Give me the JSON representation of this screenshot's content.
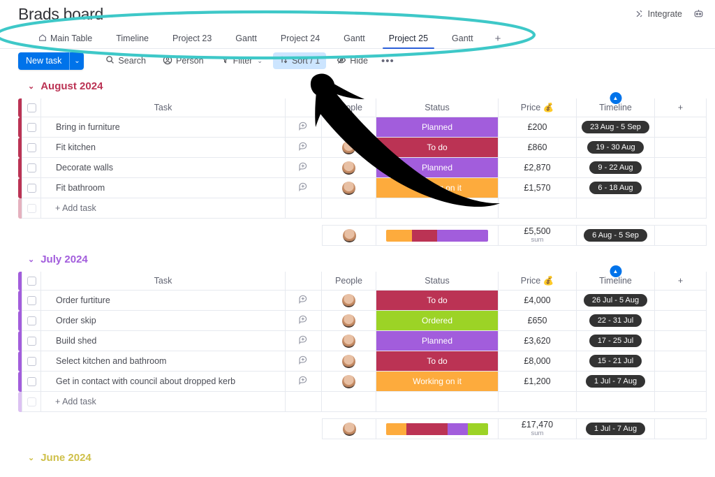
{
  "header": {
    "board_title": "Brads board",
    "title_caret": "⌄",
    "integrate_label": "Integrate",
    "automate_icon": "robot-icon"
  },
  "tabs": [
    {
      "label": "Main Table",
      "icon": "home-icon",
      "active": false
    },
    {
      "label": "Timeline",
      "active": false
    },
    {
      "label": "Project 23",
      "active": false
    },
    {
      "label": "Gantt",
      "active": false
    },
    {
      "label": "Project 24",
      "active": false
    },
    {
      "label": "Gantt",
      "active": false
    },
    {
      "label": "Project 25",
      "active": true
    },
    {
      "label": "Gantt",
      "active": false
    }
  ],
  "tab_add_label": "+",
  "toolbar": {
    "new_task_label": "New task",
    "new_task_caret": "⌄",
    "search_label": "Search",
    "person_label": "Person",
    "filter_label": "Filter",
    "filter_caret": "⌄",
    "sort_label": "Sort / 1",
    "hide_label": "Hide",
    "more_label": "•••"
  },
  "columns": {
    "task": "Task",
    "people": "People",
    "status": "Status",
    "price": "Price 💰",
    "timeline": "Timeline",
    "add": "+"
  },
  "status_colors": {
    "planned": "#a25ddc",
    "todo": "#bb3354",
    "working": "#fdab3d",
    "ordered": "#9cd326"
  },
  "accent_colors": {
    "august": "#bb3354",
    "july": "#a25ddc",
    "june": "#cfc04a"
  },
  "add_task_label": "+ Add task",
  "sum_label": "sum",
  "groups": [
    {
      "name": "August 2024",
      "caret": "⌄",
      "accent": "#bb3354",
      "rows": [
        {
          "task": "Bring in furniture",
          "status": "Planned",
          "status_color": "#a25ddc",
          "price": "£200",
          "timeline": "23 Aug - 5 Sep"
        },
        {
          "task": "Fit kitchen",
          "status": "To do",
          "status_color": "#bb3354",
          "price": "£860",
          "timeline": "19 - 30 Aug"
        },
        {
          "task": "Decorate walls",
          "status": "Planned",
          "status_color": "#a25ddc",
          "price": "£2,870",
          "timeline": "9 - 22 Aug"
        },
        {
          "task": "Fit bathroom",
          "status": "Working on it",
          "status_color": "#fdab3d",
          "price": "£1,570",
          "timeline": "6 - 18 Aug"
        }
      ],
      "summary": {
        "price": "£5,500",
        "timeline": "6 Aug - 5 Sep",
        "bar": [
          {
            "color": "#fdab3d",
            "pct": 25
          },
          {
            "color": "#bb3354",
            "pct": 25
          },
          {
            "color": "#a25ddc",
            "pct": 50
          }
        ]
      }
    },
    {
      "name": "July 2024",
      "caret": "⌄",
      "accent": "#a25ddc",
      "rows": [
        {
          "task": "Order furtiture",
          "status": "To do",
          "status_color": "#bb3354",
          "price": "£4,000",
          "timeline": "26 Jul - 5 Aug"
        },
        {
          "task": "Order skip",
          "status": "Ordered",
          "status_color": "#9cd326",
          "price": "£650",
          "timeline": "22 - 31 Jul"
        },
        {
          "task": "Build shed",
          "status": "Planned",
          "status_color": "#a25ddc",
          "price": "£3,620",
          "timeline": "17 - 25 Jul"
        },
        {
          "task": "Select kitchen and bathroom",
          "status": "To do",
          "status_color": "#bb3354",
          "price": "£8,000",
          "timeline": "15 - 21 Jul"
        },
        {
          "task": "Get in contact with council about dropped kerb",
          "status": "Working on it",
          "status_color": "#fdab3d",
          "price": "£1,200",
          "timeline": "1 Jul - 7 Aug"
        }
      ],
      "summary": {
        "price": "£17,470",
        "timeline": "1 Jul - 7 Aug",
        "bar": [
          {
            "color": "#fdab3d",
            "pct": 20
          },
          {
            "color": "#bb3354",
            "pct": 40
          },
          {
            "color": "#a25ddc",
            "pct": 20
          },
          {
            "color": "#9cd326",
            "pct": 20
          }
        ]
      }
    }
  ],
  "june_group": {
    "name": "June 2024",
    "caret": "⌄",
    "accent": "#cfc04a"
  },
  "annotations": {
    "ellipse_color": "#3ec8c8",
    "arrow_color": "#000000"
  }
}
